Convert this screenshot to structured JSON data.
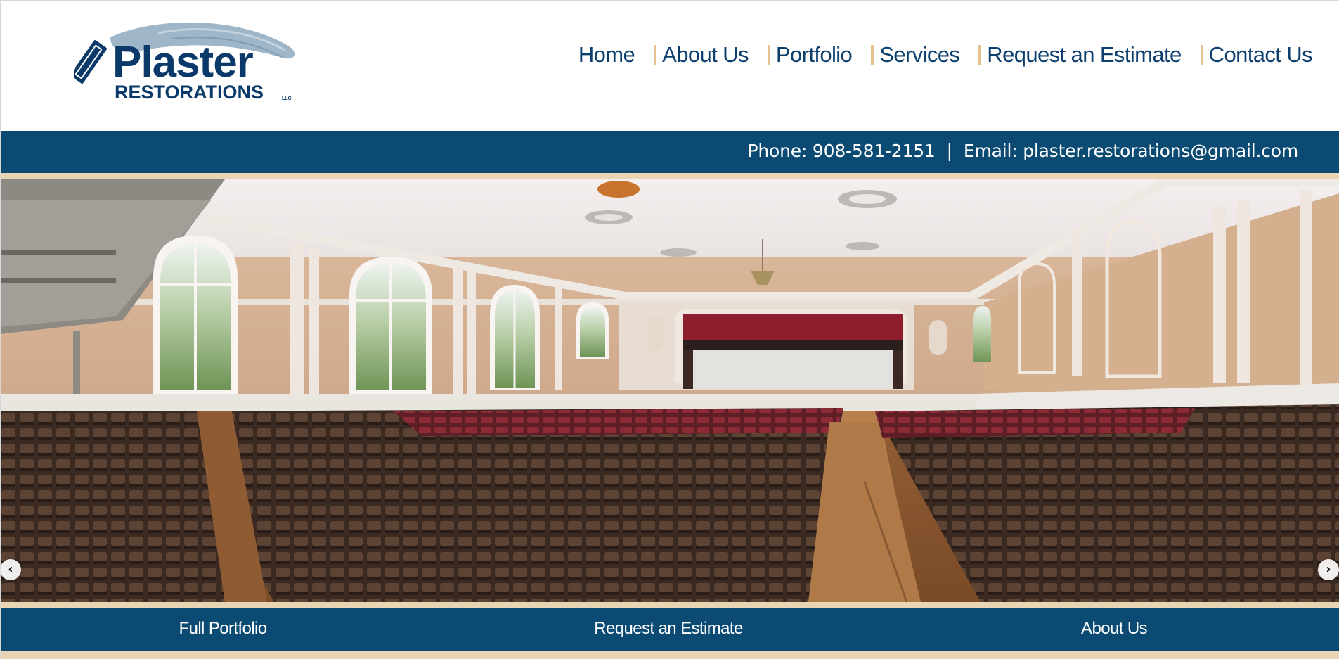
{
  "logo": {
    "main": "Plaster",
    "sub": "RESTORATIONS",
    "llc": "LLC"
  },
  "nav": {
    "items": [
      {
        "label": "Home"
      },
      {
        "label": "About Us"
      },
      {
        "label": "Portfolio"
      },
      {
        "label": "Services"
      },
      {
        "label": "Request an Estimate"
      },
      {
        "label": "Contact Us"
      }
    ]
  },
  "contact": {
    "phone": "Phone: 908-581-2151",
    "separator": "|",
    "email": "Email: plaster.restorations@gmail.com"
  },
  "slider": {
    "prev_icon": "chevron-left-icon",
    "next_icon": "chevron-right-icon",
    "prev_glyph": "‹",
    "next_glyph": "›"
  },
  "bottom_links": [
    {
      "label": "Full Portfolio"
    },
    {
      "label": "Request an Estimate"
    },
    {
      "label": "About Us"
    }
  ],
  "colors": {
    "brand_navy": "#0b4a72",
    "logo_navy": "#0b3a6a",
    "accent_tan": "#e8d5b3",
    "nav_separator": "#e6c28f"
  }
}
